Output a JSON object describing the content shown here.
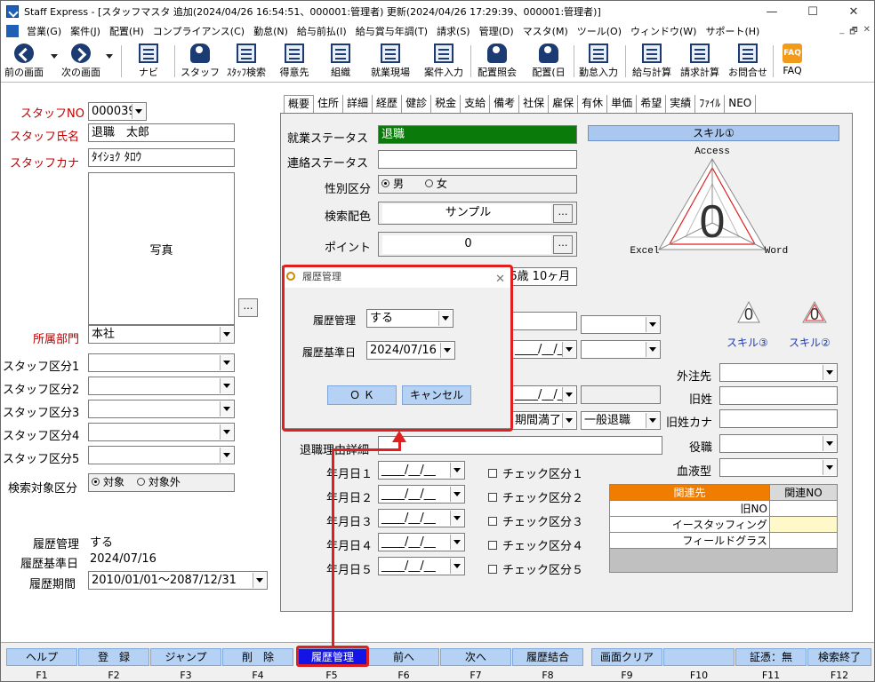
{
  "window": {
    "title": "Staff Express - [スタッフマスタ 追加(2024/04/26 16:54:51、000001:管理者) 更新(2024/04/26 17:29:39、000001:管理者)]",
    "minimize": "—",
    "maximize": "☐",
    "close": "✕"
  },
  "menu": [
    "営業(G)",
    "案件(J)",
    "配置(H)",
    "コンプライアンス(C)",
    "勤怠(N)",
    "給与前払(I)",
    "給与賞与年調(T)",
    "請求(S)",
    "管理(D)",
    "マスタ(M)",
    "ツール(O)",
    "ウィンドウ(W)",
    "サポート(H)"
  ],
  "mdi_controls": [
    "_",
    "🗗",
    "✕"
  ],
  "toolbar": {
    "prev": "前の画面",
    "next": "次の画面",
    "navi": "ナビ",
    "staff": "スタッフ",
    "staff_search": "ｽﾀｯﾌ検索",
    "client": "得意先",
    "org": "組織",
    "site": "就業現場",
    "job_input": "案件入力",
    "assign_inquiry": "配置照会",
    "assign_day": "配置(日",
    "attendance": "勤怠入力",
    "payroll": "給与計算",
    "billing": "請求計算",
    "contact": "お問合せ",
    "faq": "FAQ",
    "faq_icon": "FAQ"
  },
  "left": {
    "staff_no_label": "スタッフNO",
    "staff_no": "000039",
    "staff_name_label": "スタッフ氏名",
    "staff_name": "退職　太郎",
    "staff_kana_label": "スタッフカナ",
    "staff_kana": "ﾀｲｼｮｸ ﾀﾛｳ",
    "photo_label": "写真",
    "dept_label": "所属部門",
    "dept": "本社",
    "class1": "スタッフ区分1",
    "class2": "スタッフ区分2",
    "class3": "スタッフ区分3",
    "class4": "スタッフ区分4",
    "class5": "スタッフ区分5",
    "search_target_label": "検索対象区分",
    "search_target_on": "対象",
    "search_target_off": "対象外",
    "history_mgmt_label": "履歴管理",
    "history_mgmt": "する",
    "history_date_label": "履歴基準日",
    "history_date": "2024/07/16",
    "history_period_label": "履歴期間",
    "history_period": "2010/01/01～2087/12/31"
  },
  "tabs": [
    "概要",
    "住所",
    "詳細",
    "経歴",
    "健診",
    "税金",
    "支給",
    "備考",
    "社保",
    "雇保",
    "有休",
    "単価",
    "希望",
    "実績",
    "ﾌｧｲﾙ",
    "NEO"
  ],
  "overview": {
    "work_status_label": "就業ステータス",
    "work_status": "退職",
    "work_status_color": "#0a7a0a",
    "contact_status_label": "連絡ステータス",
    "gender_label": "性別区分",
    "male": "男",
    "female": "女",
    "search_color_label": "検索配色",
    "search_color": "サンプル",
    "point_label": "ポイント",
    "point": "0",
    "age": "36歳 10ヶ月",
    "date_blank": "____/__/__",
    "reason1": "期間満了",
    "reason2": "一般退職",
    "retire_detail_label": "退職理由詳細",
    "date1_label": "年月日１",
    "date2_label": "年月日２",
    "date3_label": "年月日３",
    "date4_label": "年月日４",
    "date5_label": "年月日５",
    "check1": "チェック区分１",
    "check2": "チェック区分２",
    "check3": "チェック区分３",
    "check4": "チェック区分４",
    "check5": "チェック区分５"
  },
  "right": {
    "skill1": "スキル①",
    "skill2": "スキル②",
    "skill3": "スキル③",
    "radar_top": "Access",
    "radar_left": "Excel",
    "radar_right": "Word",
    "radar_value": "0",
    "outsource_label": "外注先",
    "old_name_label": "旧姓",
    "old_kana_label": "旧姓カナ",
    "position_label": "役職",
    "blood_label": "血液型",
    "rel_header1": "関連先",
    "rel_header2": "関連NO",
    "rel_rows": [
      "旧NO",
      "イースタッフィング",
      "フィールドグラス"
    ]
  },
  "dialog": {
    "title": "履歴管理",
    "mgmt_label": "履歴管理",
    "mgmt_value": "する",
    "date_label": "履歴基準日",
    "date_value": "2024/07/16",
    "ok": "Ｏ Ｋ",
    "cancel": "キャンセル"
  },
  "fkeys": [
    {
      "label": "ヘルプ",
      "key": "F1"
    },
    {
      "label": "登　録",
      "key": "F2"
    },
    {
      "label": "ジャンプ",
      "key": "F3"
    },
    {
      "label": "削　除",
      "key": "F4"
    },
    {
      "label": "履歴管理",
      "key": "F5"
    },
    {
      "label": "前へ",
      "key": "F6"
    },
    {
      "label": "次へ",
      "key": "F7"
    },
    {
      "label": "履歴結合",
      "key": "F8"
    },
    {
      "label": "画面クリア",
      "key": "F9"
    },
    {
      "label": "",
      "key": "F10"
    },
    {
      "label": "証憑：無",
      "key": "F11"
    },
    {
      "label": "検索終了",
      "key": "F12"
    }
  ],
  "colors": {
    "highlight": "#e02020",
    "fkey_active": "#1414e6",
    "fkey": "#b5d2f4"
  }
}
